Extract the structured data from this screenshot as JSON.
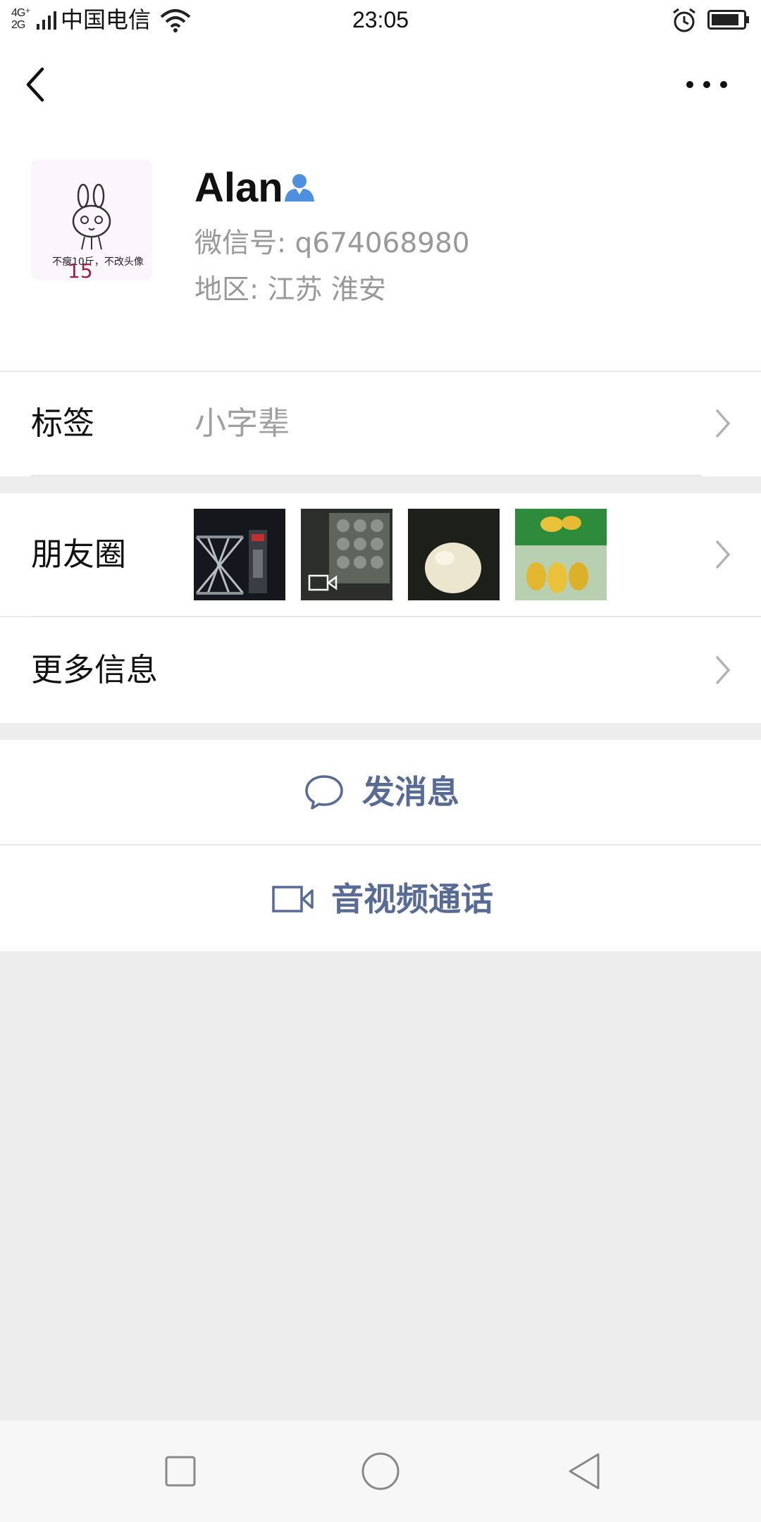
{
  "status_bar": {
    "network_label": "4G+ 2G",
    "carrier": "中国电信",
    "time": "23:05",
    "icons": [
      "signal-icon",
      "wifi-icon",
      "alarm-icon",
      "battery-icon"
    ]
  },
  "header": {
    "back_icon": "chevron-left-icon",
    "more_icon": "more-dots-icon"
  },
  "profile": {
    "name": "Alan",
    "verified_icon": "person-icon",
    "wechat_id": "微信号: q674068980",
    "region": "地区: 江苏  淮安",
    "avatar_caption": "不瘦10斤，不改头像",
    "avatar_mark": "15"
  },
  "tags_row": {
    "label": "标签",
    "value": "小字辈"
  },
  "moments_row": {
    "label": "朋友圈",
    "thumbnails": [
      {
        "name": "moments-thumb-gate",
        "icon": "image"
      },
      {
        "name": "moments-thumb-video",
        "icon": "video-icon"
      },
      {
        "name": "moments-thumb-fruit",
        "icon": "image"
      },
      {
        "name": "moments-thumb-durian",
        "icon": "image"
      }
    ]
  },
  "more_info_row": {
    "label": "更多信息"
  },
  "actions": {
    "send_message": "发消息",
    "video_call": "音视频通话"
  },
  "colors": {
    "link_blue": "#576b95",
    "background": "#ededed",
    "verified_blue": "#4e8fe0"
  },
  "system_nav": {
    "recent_icon": "square-icon",
    "home_icon": "circle-icon",
    "back_icon": "triangle-back-icon"
  }
}
